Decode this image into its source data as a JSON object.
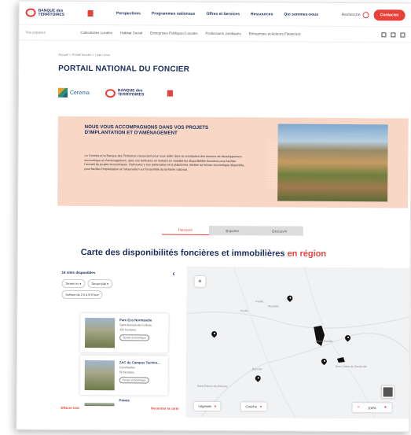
{
  "header": {
    "logo_text": "BANQUE des TERRITOIRES",
    "nav": [
      "Perspectives",
      "Programmes nationaux",
      "Offres et Services",
      "Ressources",
      "Qui sommes-nous"
    ],
    "search_label": "Recherche",
    "contact_label": "Contactez"
  },
  "subnav": {
    "label": "Vos espaces",
    "items": [
      "Collectivités Locales",
      "Habitat Social",
      "Entreprises Publiques Locales",
      "Professions Juridiques",
      "Entreprises et Acteurs Financiers"
    ]
  },
  "breadcrumb": "Accueil > Portail foncier > Liste Lieux",
  "page_title": "PORTAIL NATIONAL DU FONCIER",
  "partners": {
    "cerema": "Cerema"
  },
  "hero": {
    "heading": "NOUS VOUS ACCOMPAGNONS DANS VOS PROJETS D'IMPLANTATION ET D'AMÉNAGEMENT",
    "body": "Le Cerema et la Banque des Territoires s'associent pour vous aider dans la constitution des besoins de développement économique et d'aménagement, dans vos territoires en mettant en visibilité les disponibilités foncières pour faciliter l'accueil de projets économiques. Retrouvez-y nos partenaires et la plateforme, dédiée au foncier économique disponible, pour faciliter l'implantation et l'observation sur l'ensemble du territoire national."
  },
  "tabs": [
    {
      "label": "Parcourir",
      "active": true
    },
    {
      "label": "Exporter",
      "active": false
    },
    {
      "label": "Découvrir",
      "active": false
    }
  ],
  "map_title": {
    "main": "Carte des disponibilités foncières et immobilières",
    "accent": "en région"
  },
  "panel": {
    "heading": "18 sites disponibles",
    "filters": [
      "Terrain nu",
      "Terrain bâti",
      "Surface de 2,5 à 9,9 ha"
    ],
    "cards": [
      {
        "title": "Parc Eco Normandie",
        "sub": "Saint-Romain-de-Colbosc",
        "sub2": "101 hectares",
        "tag": "Terrain économique"
      },
      {
        "title": "ZAC du Campus Techno...",
        "sub": "Colombelles",
        "sub2": "50 hectares",
        "tag": "Terrain économique"
      },
      {
        "title": "Pasais",
        "sub": "",
        "sub2": "",
        "tag": ""
      }
    ],
    "footer_left": "Effacer tout",
    "footer_right": "Recentrer la carte"
  },
  "map": {
    "labels": [
      "Yerville",
      "Pavilly",
      "Montville",
      "Saint-Romain",
      "Notre-Dame-de-Bondeville",
      "Barentin",
      "Saint-Étienne-du-Rouvray"
    ],
    "legend_label": "Légende",
    "layer_label": "Couche",
    "zoom_label": "100%"
  },
  "colors": {
    "brand_red": "#e8413a",
    "navy": "#1b2d5b",
    "hero_bg": "#f8d7c6"
  }
}
